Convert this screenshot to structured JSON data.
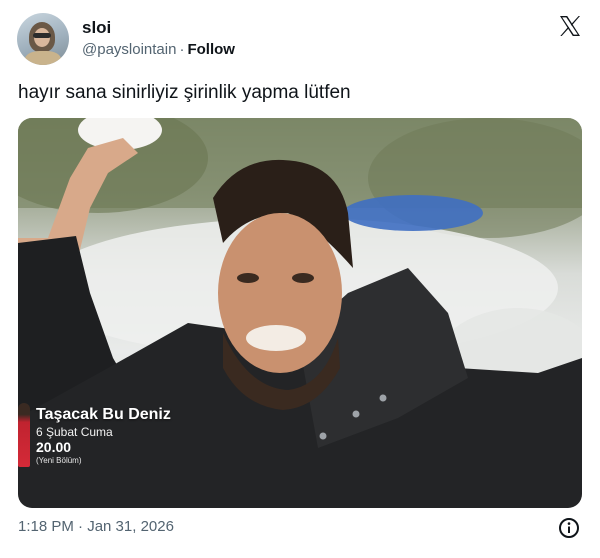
{
  "author": {
    "display_name": "sloi",
    "handle": "@payslointain",
    "separator": "·",
    "follow_label": "Follow"
  },
  "tweet": {
    "text": "hayır sana sinirliyiz şirinlik yapma lütfen",
    "timestamp": "1:18 PM · Jan 31, 2026"
  },
  "media": {
    "overlay_title": "Taşacak Bu Deniz",
    "overlay_date": "6 Şubat Cuma",
    "overlay_time": "20.00",
    "overlay_subtitle": "(Yeni Bölüm)"
  },
  "icons": {
    "platform_logo": "x-logo-icon",
    "info": "info-icon"
  },
  "colors": {
    "text": "#0f1419",
    "secondary_text": "#536471",
    "background": "#ffffff"
  }
}
